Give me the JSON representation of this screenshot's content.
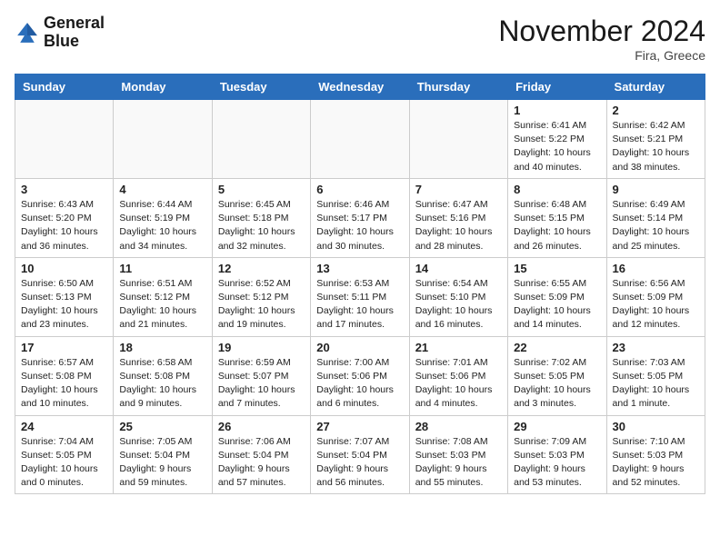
{
  "header": {
    "logo_line1": "General",
    "logo_line2": "Blue",
    "month": "November 2024",
    "location": "Fira, Greece"
  },
  "weekdays": [
    "Sunday",
    "Monday",
    "Tuesday",
    "Wednesday",
    "Thursday",
    "Friday",
    "Saturday"
  ],
  "weeks": [
    [
      {
        "day": "",
        "info": ""
      },
      {
        "day": "",
        "info": ""
      },
      {
        "day": "",
        "info": ""
      },
      {
        "day": "",
        "info": ""
      },
      {
        "day": "",
        "info": ""
      },
      {
        "day": "1",
        "info": "Sunrise: 6:41 AM\nSunset: 5:22 PM\nDaylight: 10 hours\nand 40 minutes."
      },
      {
        "day": "2",
        "info": "Sunrise: 6:42 AM\nSunset: 5:21 PM\nDaylight: 10 hours\nand 38 minutes."
      }
    ],
    [
      {
        "day": "3",
        "info": "Sunrise: 6:43 AM\nSunset: 5:20 PM\nDaylight: 10 hours\nand 36 minutes."
      },
      {
        "day": "4",
        "info": "Sunrise: 6:44 AM\nSunset: 5:19 PM\nDaylight: 10 hours\nand 34 minutes."
      },
      {
        "day": "5",
        "info": "Sunrise: 6:45 AM\nSunset: 5:18 PM\nDaylight: 10 hours\nand 32 minutes."
      },
      {
        "day": "6",
        "info": "Sunrise: 6:46 AM\nSunset: 5:17 PM\nDaylight: 10 hours\nand 30 minutes."
      },
      {
        "day": "7",
        "info": "Sunrise: 6:47 AM\nSunset: 5:16 PM\nDaylight: 10 hours\nand 28 minutes."
      },
      {
        "day": "8",
        "info": "Sunrise: 6:48 AM\nSunset: 5:15 PM\nDaylight: 10 hours\nand 26 minutes."
      },
      {
        "day": "9",
        "info": "Sunrise: 6:49 AM\nSunset: 5:14 PM\nDaylight: 10 hours\nand 25 minutes."
      }
    ],
    [
      {
        "day": "10",
        "info": "Sunrise: 6:50 AM\nSunset: 5:13 PM\nDaylight: 10 hours\nand 23 minutes."
      },
      {
        "day": "11",
        "info": "Sunrise: 6:51 AM\nSunset: 5:12 PM\nDaylight: 10 hours\nand 21 minutes."
      },
      {
        "day": "12",
        "info": "Sunrise: 6:52 AM\nSunset: 5:12 PM\nDaylight: 10 hours\nand 19 minutes."
      },
      {
        "day": "13",
        "info": "Sunrise: 6:53 AM\nSunset: 5:11 PM\nDaylight: 10 hours\nand 17 minutes."
      },
      {
        "day": "14",
        "info": "Sunrise: 6:54 AM\nSunset: 5:10 PM\nDaylight: 10 hours\nand 16 minutes."
      },
      {
        "day": "15",
        "info": "Sunrise: 6:55 AM\nSunset: 5:09 PM\nDaylight: 10 hours\nand 14 minutes."
      },
      {
        "day": "16",
        "info": "Sunrise: 6:56 AM\nSunset: 5:09 PM\nDaylight: 10 hours\nand 12 minutes."
      }
    ],
    [
      {
        "day": "17",
        "info": "Sunrise: 6:57 AM\nSunset: 5:08 PM\nDaylight: 10 hours\nand 10 minutes."
      },
      {
        "day": "18",
        "info": "Sunrise: 6:58 AM\nSunset: 5:08 PM\nDaylight: 10 hours\nand 9 minutes."
      },
      {
        "day": "19",
        "info": "Sunrise: 6:59 AM\nSunset: 5:07 PM\nDaylight: 10 hours\nand 7 minutes."
      },
      {
        "day": "20",
        "info": "Sunrise: 7:00 AM\nSunset: 5:06 PM\nDaylight: 10 hours\nand 6 minutes."
      },
      {
        "day": "21",
        "info": "Sunrise: 7:01 AM\nSunset: 5:06 PM\nDaylight: 10 hours\nand 4 minutes."
      },
      {
        "day": "22",
        "info": "Sunrise: 7:02 AM\nSunset: 5:05 PM\nDaylight: 10 hours\nand 3 minutes."
      },
      {
        "day": "23",
        "info": "Sunrise: 7:03 AM\nSunset: 5:05 PM\nDaylight: 10 hours\nand 1 minute."
      }
    ],
    [
      {
        "day": "24",
        "info": "Sunrise: 7:04 AM\nSunset: 5:05 PM\nDaylight: 10 hours\nand 0 minutes."
      },
      {
        "day": "25",
        "info": "Sunrise: 7:05 AM\nSunset: 5:04 PM\nDaylight: 9 hours\nand 59 minutes."
      },
      {
        "day": "26",
        "info": "Sunrise: 7:06 AM\nSunset: 5:04 PM\nDaylight: 9 hours\nand 57 minutes."
      },
      {
        "day": "27",
        "info": "Sunrise: 7:07 AM\nSunset: 5:04 PM\nDaylight: 9 hours\nand 56 minutes."
      },
      {
        "day": "28",
        "info": "Sunrise: 7:08 AM\nSunset: 5:03 PM\nDaylight: 9 hours\nand 55 minutes."
      },
      {
        "day": "29",
        "info": "Sunrise: 7:09 AM\nSunset: 5:03 PM\nDaylight: 9 hours\nand 53 minutes."
      },
      {
        "day": "30",
        "info": "Sunrise: 7:10 AM\nSunset: 5:03 PM\nDaylight: 9 hours\nand 52 minutes."
      }
    ]
  ]
}
